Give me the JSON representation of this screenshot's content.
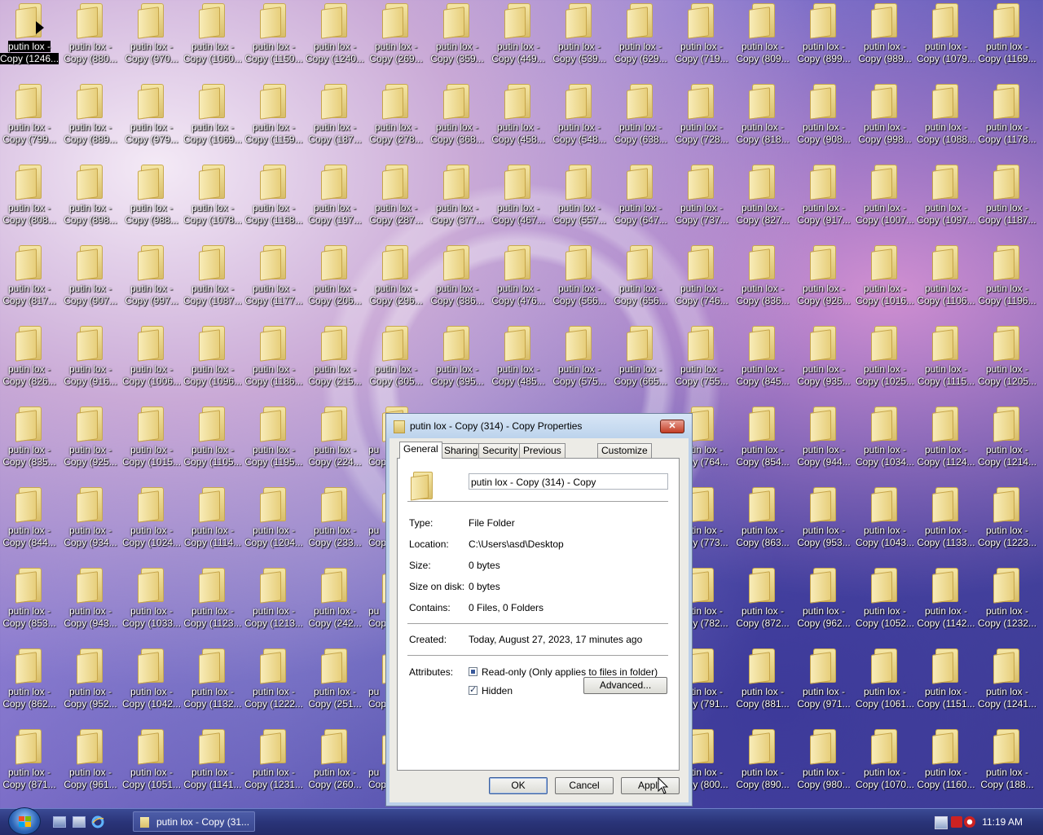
{
  "desktop": {
    "icon_line1": "putin lox -",
    "rows": [
      [
        "Copy (1246...",
        "Copy (880...",
        "Copy (970...",
        "Copy (1060...",
        "Copy (1150...",
        "Copy (1240...",
        "Copy (269...",
        "Copy (359...",
        "Copy (449...",
        "Copy (539...",
        "Copy (629...",
        "Copy (719...",
        "Copy (809...",
        "Copy (899...",
        "Copy (989...",
        "Copy (1079...",
        "Copy (1169..."
      ],
      [
        "Copy (799...",
        "Copy (889...",
        "Copy (979...",
        "Copy (1069...",
        "Copy (1159...",
        "Copy (187...",
        "Copy (278...",
        "Copy (368...",
        "Copy (458...",
        "Copy (548...",
        "Copy (638...",
        "Copy (728...",
        "Copy (818...",
        "Copy (908...",
        "Copy (998...",
        "Copy (1088...",
        "Copy (1178..."
      ],
      [
        "Copy (808...",
        "Copy (898...",
        "Copy (988...",
        "Copy (1078...",
        "Copy (1168...",
        "Copy (197...",
        "Copy (287...",
        "Copy (377...",
        "Copy (467...",
        "Copy (557...",
        "Copy (647...",
        "Copy (737...",
        "Copy (827...",
        "Copy (917...",
        "Copy (1007...",
        "Copy (1097...",
        "Copy (1187..."
      ],
      [
        "Copy (817...",
        "Copy (907...",
        "Copy (997...",
        "Copy (1087...",
        "Copy (1177...",
        "Copy (206...",
        "Copy (296...",
        "Copy (386...",
        "Copy (476...",
        "Copy (566...",
        "Copy (656...",
        "Copy (746...",
        "Copy (836...",
        "Copy (926...",
        "Copy (1016...",
        "Copy (1106...",
        "Copy (1196..."
      ],
      [
        "Copy (826...",
        "Copy (916...",
        "Copy (1006...",
        "Copy (1096...",
        "Copy (1186...",
        "Copy (215...",
        "Copy (305...",
        "Copy (395...",
        "Copy (485...",
        "Copy (575...",
        "Copy (665...",
        "Copy (755...",
        "Copy (845...",
        "Copy (935...",
        "Copy (1025...",
        "Copy (1115...",
        "Copy (1205..."
      ],
      [
        "Copy (835...",
        "Copy (925...",
        "Copy (1015...",
        "Copy (1105...",
        "Copy (1195...",
        "Copy (224...",
        "Cop",
        "",
        "",
        "",
        "",
        "Copy (764...",
        "Copy (854...",
        "Copy (944...",
        "Copy (1034...",
        "Copy (1124...",
        "Copy (1214..."
      ],
      [
        "Copy (844...",
        "Copy (934...",
        "Copy (1024...",
        "Copy (1114...",
        "Copy (1204...",
        "Copy (233...",
        "Cop",
        "",
        "",
        "",
        "",
        "Copy (773...",
        "Copy (863...",
        "Copy (953...",
        "Copy (1043...",
        "Copy (1133...",
        "Copy (1223..."
      ],
      [
        "Copy (853...",
        "Copy (943...",
        "Copy (1033...",
        "Copy (1123...",
        "Copy (1213...",
        "Copy (242...",
        "Cop",
        "",
        "",
        "",
        "",
        "Copy (782...",
        "Copy (872...",
        "Copy (962...",
        "Copy (1052...",
        "Copy (1142...",
        "Copy (1232..."
      ],
      [
        "Copy (862...",
        "Copy (952...",
        "Copy (1042...",
        "Copy (1132...",
        "Copy (1222...",
        "Copy (251...",
        "Cop",
        "",
        "",
        "",
        "",
        "Copy (791...",
        "Copy (881...",
        "Copy (971...",
        "Copy (1061...",
        "Copy (1151...",
        "Copy (1241..."
      ],
      [
        "Copy (871...",
        "Copy (961...",
        "Copy (1051...",
        "Copy (1141...",
        "Copy (1231...",
        "Copy (260...",
        "Cop",
        "",
        "",
        "",
        "",
        "Copy (800...",
        "Copy (890...",
        "Copy (980...",
        "Copy (1070...",
        "Copy (1160...",
        "Copy (188..."
      ]
    ]
  },
  "dialog": {
    "title": "putin lox - Copy (314) - Copy Properties",
    "close_label": "✕",
    "tabs": [
      "General",
      "Sharing",
      "Security",
      "Previous Versions",
      "Customize"
    ],
    "active_tab": "General",
    "name_value": "putin lox - Copy (314) - Copy",
    "props": {
      "type_label": "Type:",
      "type_value": "File Folder",
      "location_label": "Location:",
      "location_value": "C:\\Users\\asd\\Desktop",
      "size_label": "Size:",
      "size_value": "0 bytes",
      "size_on_disk_label": "Size on disk:",
      "size_on_disk_value": "0 bytes",
      "contains_label": "Contains:",
      "contains_value": "0 Files, 0 Folders",
      "created_label": "Created:",
      "created_value": "Today, August 27, 2023, 17 minutes ago",
      "attributes_label": "Attributes:"
    },
    "attributes": {
      "readonly_label": "Read-only (Only applies to files in folder)",
      "readonly_state": "indeterminate",
      "hidden_label": "Hidden",
      "hidden_state": "checked",
      "advanced_label": "Advanced..."
    },
    "buttons": {
      "ok": "OK",
      "cancel": "Cancel",
      "apply": "Apply"
    }
  },
  "taskbar": {
    "task_title": "putin lox - Copy (31...",
    "clock": "11:19 AM"
  }
}
